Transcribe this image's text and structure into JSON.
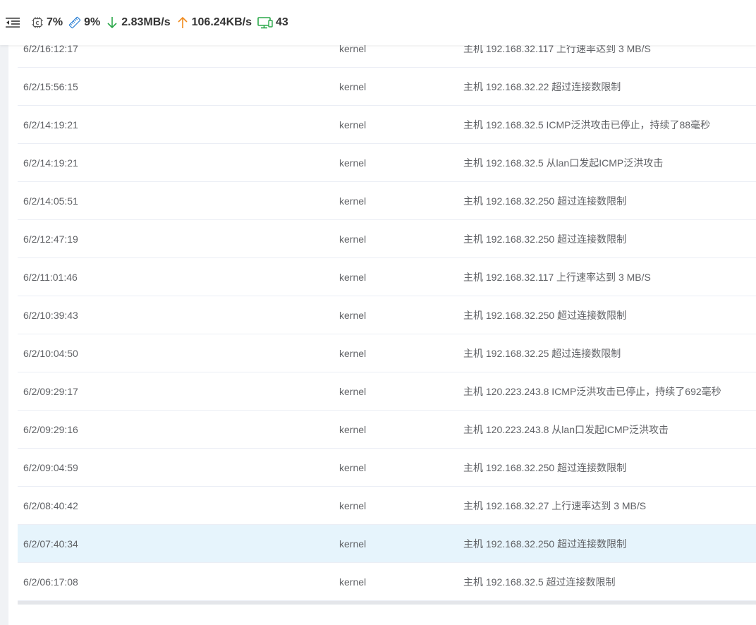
{
  "header": {
    "cpu": "7%",
    "memory": "9%",
    "download": "2.83MB/s",
    "upload": "106.24KB/s",
    "devices": "43",
    "icons": {
      "menu": "menu-fold-icon",
      "cpu": "cpu-chip-icon",
      "memory": "memory-stick-icon",
      "download": "arrow-down-icon",
      "upload": "arrow-up-icon",
      "devices": "monitor-icon"
    },
    "colors": {
      "download": "#2ba84a",
      "upload": "#f08a1c",
      "memory": "#2a7fd4",
      "devices": "#2ba84a"
    }
  },
  "logs": [
    {
      "time": "6/2/16:12:17",
      "source": "kernel",
      "message": "主机 192.168.32.117 上行速率达到 3 MB/S"
    },
    {
      "time": "6/2/15:56:15",
      "source": "kernel",
      "message": "主机 192.168.32.22 超过连接数限制"
    },
    {
      "time": "6/2/14:19:21",
      "source": "kernel",
      "message": "主机 192.168.32.5 ICMP泛洪攻击已停止，持续了88毫秒"
    },
    {
      "time": "6/2/14:19:21",
      "source": "kernel",
      "message": "主机 192.168.32.5 从lan口发起ICMP泛洪攻击"
    },
    {
      "time": "6/2/14:05:51",
      "source": "kernel",
      "message": "主机 192.168.32.250 超过连接数限制"
    },
    {
      "time": "6/2/12:47:19",
      "source": "kernel",
      "message": "主机 192.168.32.250 超过连接数限制"
    },
    {
      "time": "6/2/11:01:46",
      "source": "kernel",
      "message": "主机 192.168.32.117 上行速率达到 3 MB/S"
    },
    {
      "time": "6/2/10:39:43",
      "source": "kernel",
      "message": "主机 192.168.32.250 超过连接数限制"
    },
    {
      "time": "6/2/10:04:50",
      "source": "kernel",
      "message": "主机 192.168.32.25 超过连接数限制"
    },
    {
      "time": "6/2/09:29:17",
      "source": "kernel",
      "message": "主机 120.223.243.8 ICMP泛洪攻击已停止，持续了692毫秒"
    },
    {
      "time": "6/2/09:29:16",
      "source": "kernel",
      "message": "主机 120.223.243.8 从lan口发起ICMP泛洪攻击"
    },
    {
      "time": "6/2/09:04:59",
      "source": "kernel",
      "message": "主机 192.168.32.250 超过连接数限制"
    },
    {
      "time": "6/2/08:40:42",
      "source": "kernel",
      "message": "主机 192.168.32.27 上行速率达到 3 MB/S"
    },
    {
      "time": "6/2/07:40:34",
      "source": "kernel",
      "message": "主机 192.168.32.250 超过连接数限制",
      "highlighted": true
    },
    {
      "time": "6/2/06:17:08",
      "source": "kernel",
      "message": "主机 192.168.32.5 超过连接数限制"
    }
  ]
}
